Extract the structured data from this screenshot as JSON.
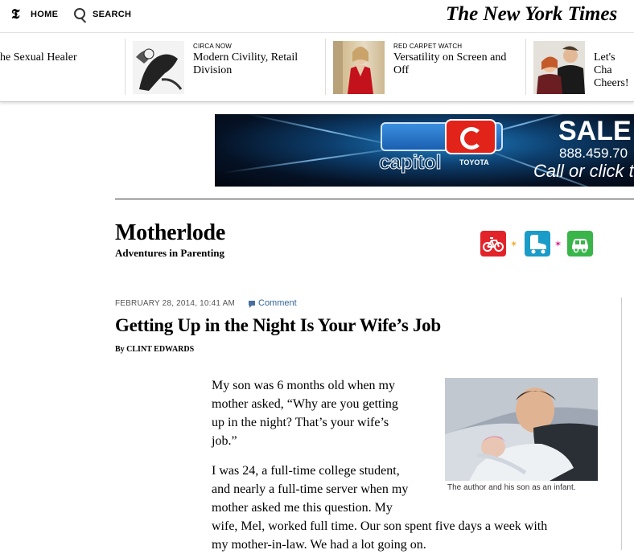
{
  "topbar": {
    "logo_glyph": "𝕿",
    "home": "HOME",
    "search": "SEARCH",
    "brand": "The New York Times"
  },
  "promos": [
    {
      "title": "he Sexual Healer"
    },
    {
      "kicker": "CIRCA NOW",
      "title_l1": "Modern Civility, Retail",
      "title_l2": "Division"
    },
    {
      "kicker": "RED CARPET WATCH",
      "title_l1": "Versatility on Screen and",
      "title_l2": "Off"
    },
    {
      "title_l1": "Let's Cha",
      "title_l2": "Cheers!"
    }
  ],
  "ad": {
    "brand": "capitol",
    "dealer": "TOYOTA",
    "sale": "SALE",
    "phone": "888.459.70",
    "cta": "Call or click t"
  },
  "blog": {
    "name": "Motherlode",
    "tagline": "Adventures in Parenting"
  },
  "article": {
    "date": "FEBRUARY 28, 2014, 10:41 AM",
    "comment_label": "Comment",
    "headline": "Getting Up in the Night Is Your Wife’s Job",
    "byline": "By CLINT EDWARDS",
    "p1": [
      "My son was 6 months old when my",
      "mother asked, “Why are you getting",
      "up in the night? That’s your wife’s",
      "job.”"
    ],
    "p2": [
      "I was 24, a full-time college student,",
      "and nearly a full-time server when my",
      "mother asked me this question. My",
      "wife, Mel, worked full time. Our son spent five days a week with",
      "my mother-in-law. We had a lot going on."
    ],
    "photo_caption": "The author and his son as an infant."
  }
}
